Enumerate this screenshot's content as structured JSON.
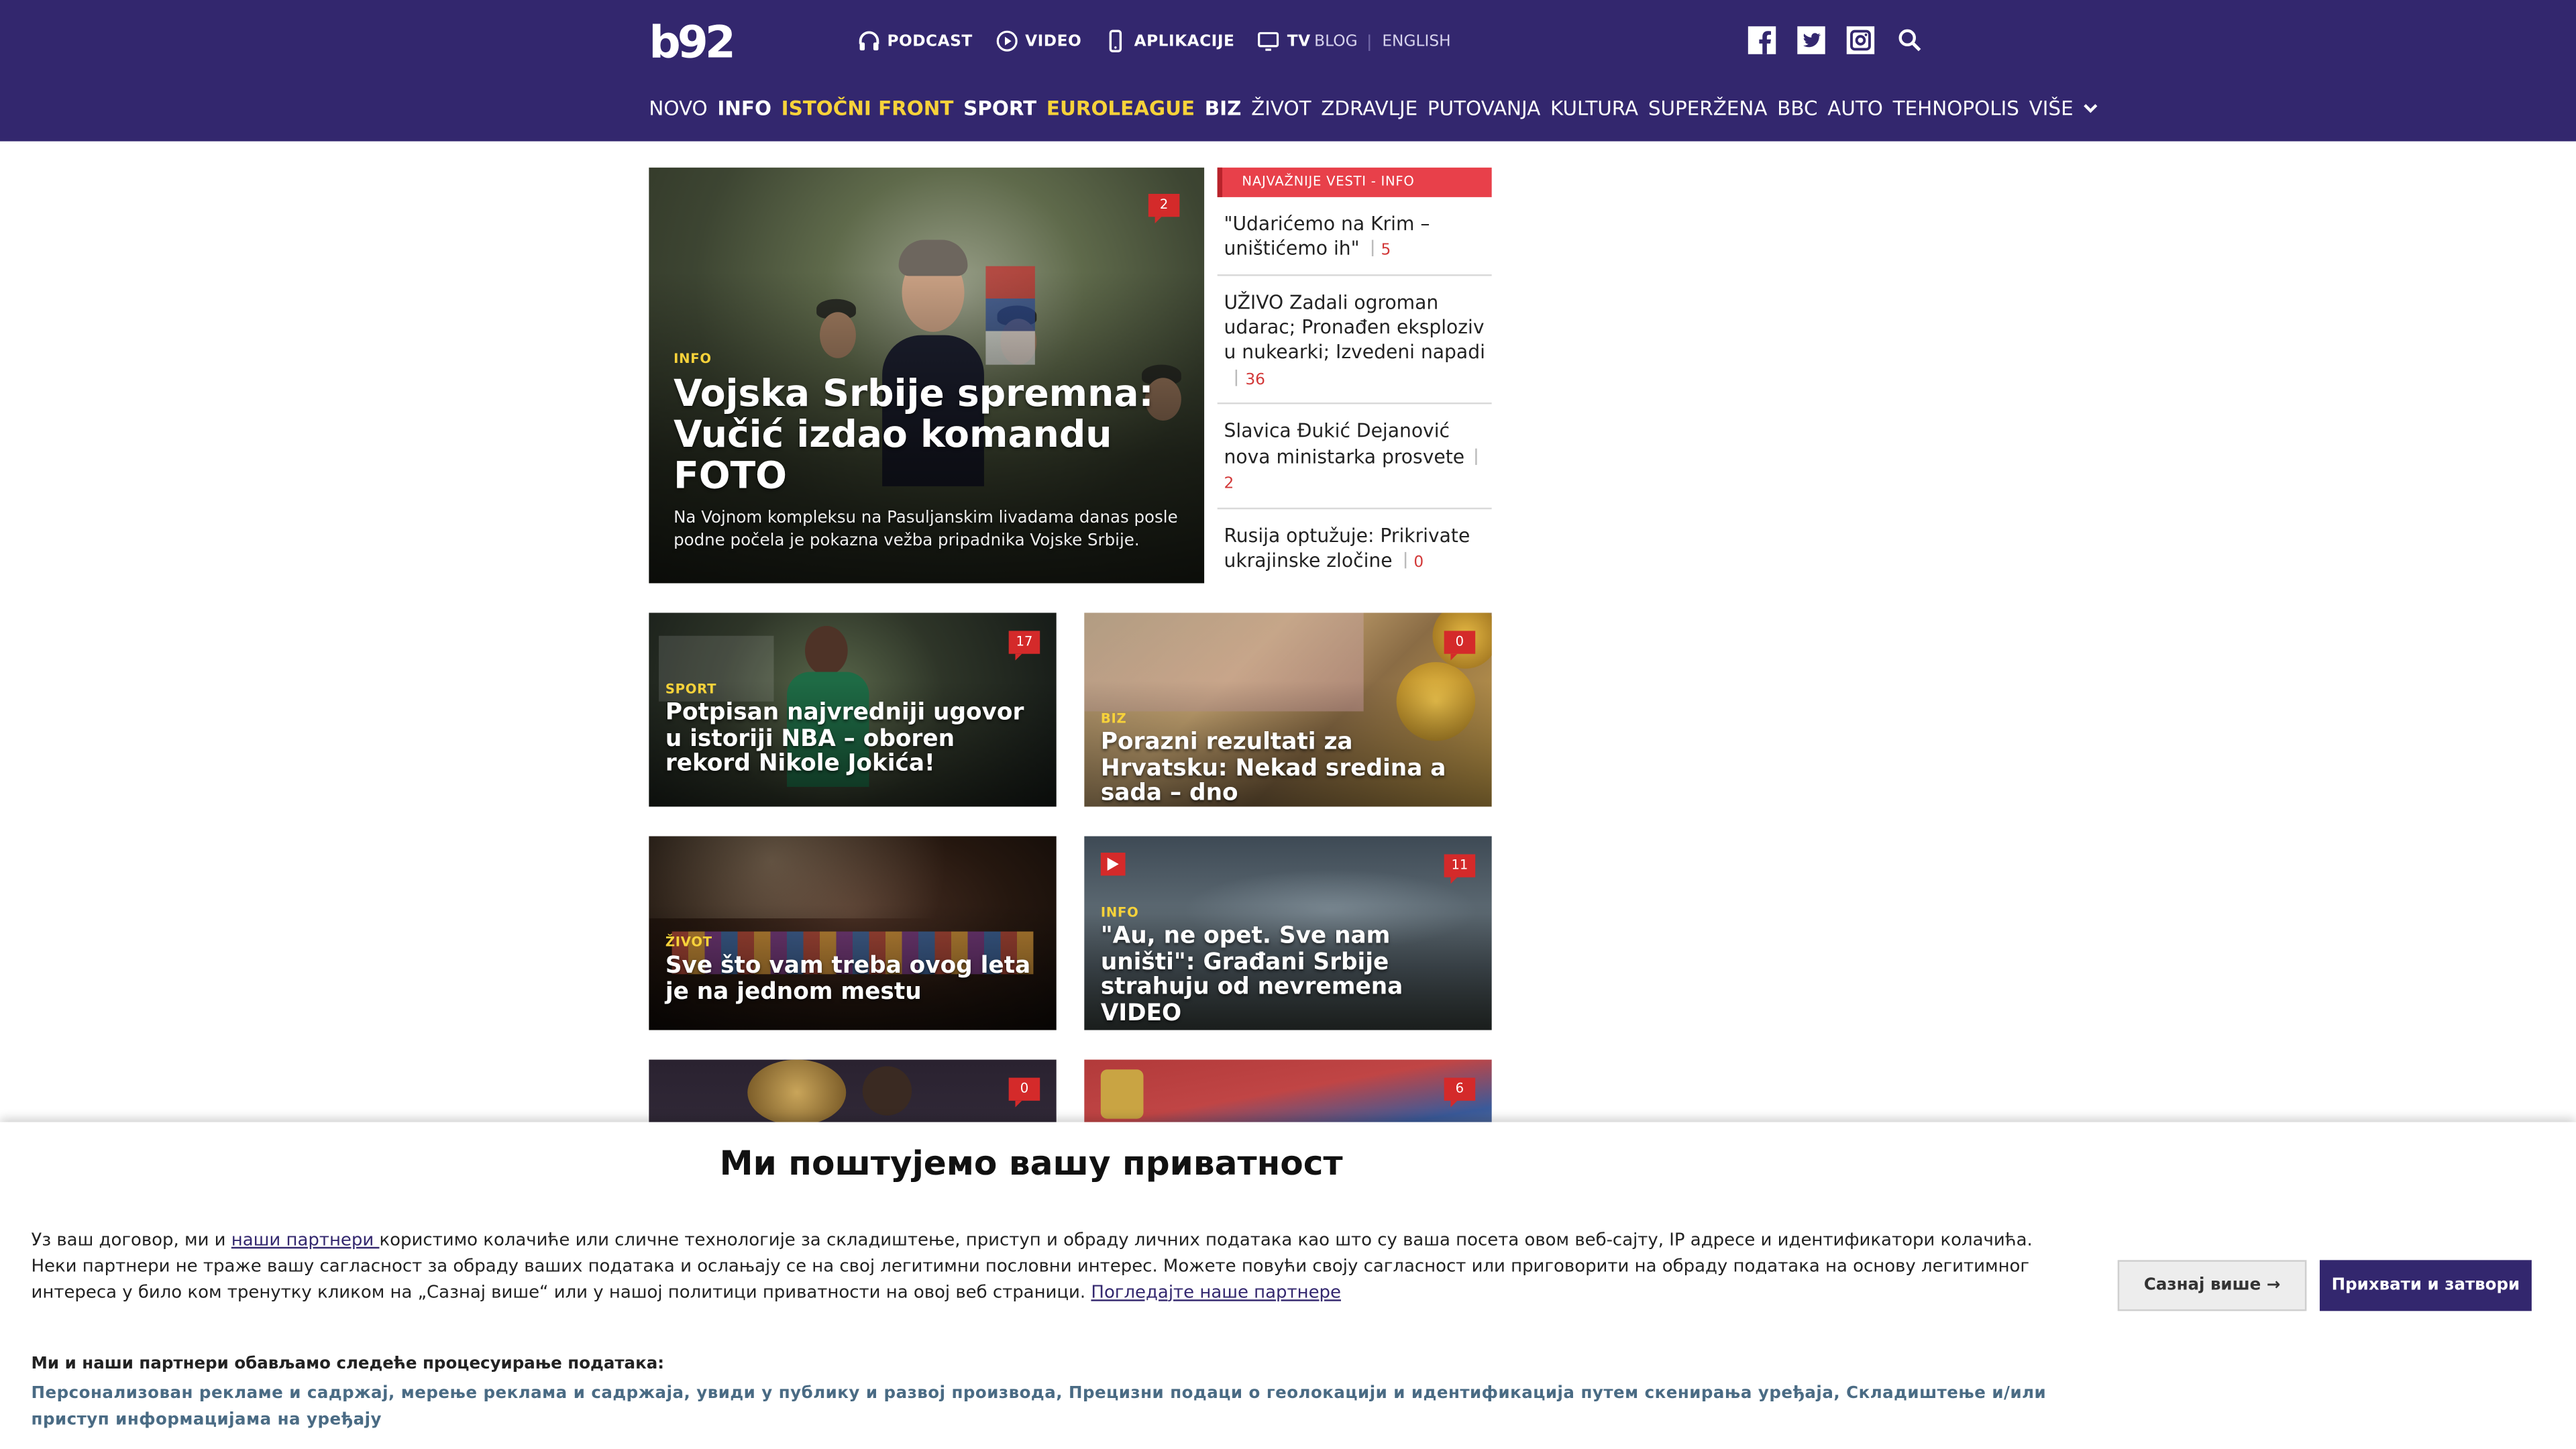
{
  "header": {
    "logo": "b92",
    "topnav": [
      {
        "label": "PODCAST",
        "icon": "headphones-icon"
      },
      {
        "label": "VIDEO",
        "icon": "play-circle-icon"
      },
      {
        "label": "APLIKACIJE",
        "icon": "phone-icon"
      },
      {
        "label": "TV",
        "icon": "tv-icon"
      }
    ],
    "toplinks": [
      "BLOG",
      "ENGLISH"
    ],
    "social": [
      "facebook-icon",
      "twitter-icon",
      "instagram-icon",
      "search-icon"
    ],
    "mainnav": [
      {
        "label": "NOVO"
      },
      {
        "label": "INFO"
      },
      {
        "label": "ISTOČNI FRONT"
      },
      {
        "label": "SPORT"
      },
      {
        "label": "EUROLEAGUE"
      },
      {
        "label": "BIZ"
      },
      {
        "label": "ŽIVOT"
      },
      {
        "label": "ZDRAVLJE"
      },
      {
        "label": "PUTOVANJA"
      },
      {
        "label": "KULTURA"
      },
      {
        "label": "SUPERŽENA"
      },
      {
        "label": "BBC"
      },
      {
        "label": "AUTO"
      },
      {
        "label": "TEHNOPOLIS"
      },
      {
        "label": "VIŠE"
      }
    ],
    "colors": {
      "bg": "#33276e",
      "highlight": "#f7d23a"
    }
  },
  "hero": {
    "category": "INFO",
    "title": "Vojska Srbije spremna: Vučić izdao komandu FOTO",
    "lead": "Na Vojnom kompleksu na Pasuljanskim livadama danas posle podne počela je pokazna vežba pripadnika Vojske Srbije.",
    "comments": "2"
  },
  "sidebar": {
    "heading": "NAJVAŽNIJE VESTI - INFO",
    "items": [
      {
        "title": "\"Udarićemo na Krim – uništićemo ih\"",
        "comments": "5"
      },
      {
        "title": "UŽIVO Zadali ogroman udarac; Pronađen eksploziv u nukearki; Izvedeni napadi",
        "comments": "36"
      },
      {
        "title": "Slavica Đukić Dejanović nova ministarka prosvete",
        "comments": "2"
      },
      {
        "title": "Rusija optužuje: Prikrivate ukrajinske zločine",
        "comments": "0"
      }
    ]
  },
  "cards": [
    {
      "category": "SPORT",
      "title": "Potpisan najvredniji ugovor u istoriji NBA – oboren rekord Nikole Jokića!",
      "comments": "17"
    },
    {
      "category": "BIZ",
      "title": "Porazni rezultati za Hrvatsku: Nekad sredina a sada – dno",
      "comments": "0"
    },
    {
      "category": "ŽIVOT",
      "title": "Sve što vam treba ovog leta je na jednom mestu",
      "comments": ""
    },
    {
      "category": "INFO",
      "title": "\"Au, ne opet. Sve nam uništi\": Građani Srbije strahuju od nevremena VIDEO",
      "comments": "11"
    },
    {
      "category": "",
      "title": "",
      "comments": "0"
    },
    {
      "category": "",
      "title": "",
      "comments": "6"
    }
  ],
  "cookie": {
    "heading": "Ми поштујемо вашу приватност",
    "text_before_link": "Уз ваш договор, ми и ",
    "partners_link": "наши партнери ",
    "text_after_link": "користимо колачиће или сличне технологије за складиштење, приступ и обраду личних података као што су ваша посета овом веб-сајту, IP адресе и идентификатори колачића. Неки партнери не траже вашу сагласност за обраду ваших података и ослањају се на свој легитимни пословни интерес. Можете повући своју сагласност или приговорити на обраду података на основу легитимног интереса у било ком тренутку кликом на „Сазнај више“ или у нашој политици приватности на овој веб страници. ",
    "view_partners": "Погледајте наше партнере",
    "purposes_heading": "Ми и наши партнери обављамо следеће процесуирање података:",
    "purposes": "Персонализован рекламе и садржај, мерење реклама и садржаја, увиди у публику и развој производа, Прецизни подаци о геолокацији и идентификација путем скенирања уређаја, Складиштење и/или приступ информацијама на уређају",
    "learn_more": "Сазнај више →",
    "accept": "Прихвати и затвори"
  }
}
